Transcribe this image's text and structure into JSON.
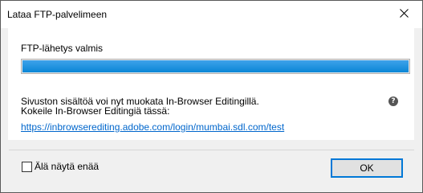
{
  "window": {
    "title": "Lataa FTP-palvelimeen"
  },
  "status": {
    "label": "FTP-lähetys valmis",
    "progress_percent": 100
  },
  "info": {
    "line1": "Sivuston sisältöä voi nyt muokata In-Browser Editingillä.",
    "line2": "Kokeile In-Browser Editingiä tässä:",
    "link": "https://inbrowserediting.adobe.com/login/mumbai.sdl.com/test"
  },
  "help_icon_glyph": "?",
  "footer": {
    "checkbox_label": "Älä näytä enää",
    "checkbox_checked": false,
    "ok_label": "OK"
  },
  "colors": {
    "progress_fill": "#0a86d6",
    "link": "#0066cc",
    "button_focus": "#0078d7"
  }
}
